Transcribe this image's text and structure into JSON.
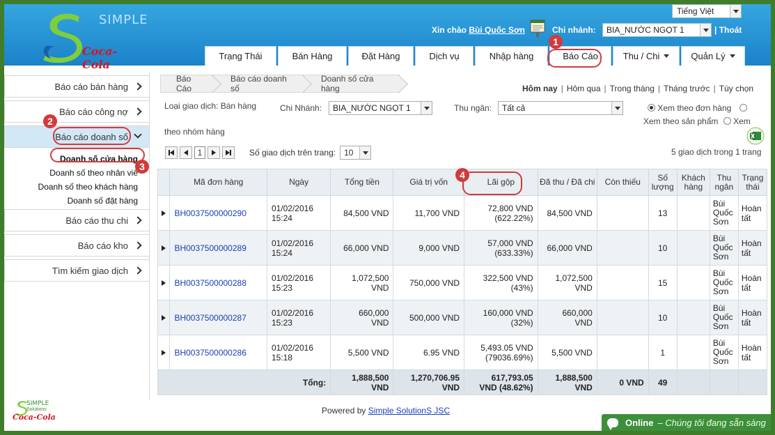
{
  "header": {
    "brand_simple": "SIMPLE",
    "brand_coke": "Coca-Cola",
    "language": "Tiếng Việt",
    "greeting_prefix": "Xin chào",
    "user_name": "Bùi Quốc Sơn",
    "branch_label": "Chi nhánh:",
    "branch_value": "BIA_NƯỚC NGỌT 1",
    "logout": "Thoát"
  },
  "nav": {
    "tabs": [
      {
        "label": "Trạng Thái"
      },
      {
        "label": "Bán Hàng"
      },
      {
        "label": "Đặt Hàng"
      },
      {
        "label": "Dịch vụ"
      },
      {
        "label": "Nhập hàng"
      },
      {
        "label": "Báo Cáo"
      },
      {
        "label": "Thu / Chi"
      },
      {
        "label": "Quản Lý"
      }
    ]
  },
  "sidebar": {
    "items": [
      {
        "label": "Báo cáo bán hàng"
      },
      {
        "label": "Báo cáo công nợ"
      },
      {
        "label": "Báo cáo doanh số"
      },
      {
        "label": "Báo cáo thu chi"
      },
      {
        "label": "Báo cáo kho"
      },
      {
        "label": "Tìm kiếm giao dịch"
      }
    ],
    "sub_items": [
      {
        "label": "Doanh số cửa hàng"
      },
      {
        "label": "Doanh số theo nhân viê"
      },
      {
        "label": "Doanh số theo khách hàng"
      },
      {
        "label": "Doanh số đặt hàng"
      }
    ],
    "logo_simple": "SIMPLE",
    "logo_solutions": "Solutions",
    "logo_coke": "Coca-Cola"
  },
  "breadcrumb": [
    "Báo Cáo",
    "Báo cáo doanh số",
    "Doanh số cửa hàng"
  ],
  "date_filters": [
    "Hôm nay",
    "Hôm qua",
    "Trong tháng",
    "Tháng trước",
    "Tùy chọn"
  ],
  "filters": {
    "transaction_type": "Loại giao dịch: Bán hàng",
    "branch_label": "Chi Nhánh:",
    "branch_value": "BIA_NƯỚC NGỌT 1",
    "cashier_label": "Thu ngân:",
    "cashier_value": "Tất cả",
    "view_by_order": "Xem theo đơn hàng",
    "view_by_product": "Xem theo sản phẩm",
    "view_word": "Xem",
    "group_text": "theo nhóm hàng"
  },
  "pager": {
    "page": "1",
    "per_page_label": "Số giao dịch trên trang:",
    "per_page_value": "10",
    "summary": "5 giao dịch trong 1 trang"
  },
  "table": {
    "headers": [
      "Mã đơn hàng",
      "Ngày",
      "Tổng tiền",
      "Giá trị vốn",
      "Lãi gộp",
      "Đã thu / Đã chi",
      "Còn thiếu",
      "Số lượng",
      "Khách hàng",
      "Thu ngân",
      "Trạng thái"
    ],
    "rows": [
      {
        "code": "BH0037500000290",
        "date": "01/02/2016",
        "time": "15:24",
        "total1": "84,500 VND",
        "total2": "",
        "cost1": "11,700 VND",
        "cost2": "",
        "profit": "72,800 VND",
        "profit_pct": "(622.22%)",
        "paid1": "84,500 VND",
        "paid2": "",
        "owed": "",
        "qty": "13",
        "customer": "",
        "cashier1": "Bùi",
        "cashier2": "Quốc",
        "cashier3": "Sơn",
        "status1": "Hoàn",
        "status2": "tất"
      },
      {
        "code": "BH0037500000289",
        "date": "01/02/2016",
        "time": "15:24",
        "total1": "66,000 VND",
        "total2": "",
        "cost1": "9,000 VND",
        "cost2": "",
        "profit": "57,000 VND",
        "profit_pct": "(633.33%)",
        "paid1": "66,000 VND",
        "paid2": "",
        "owed": "",
        "qty": "10",
        "customer": "",
        "cashier1": "Bùi",
        "cashier2": "Quốc",
        "cashier3": "Sơn",
        "status1": "Hoàn",
        "status2": "tất"
      },
      {
        "code": "BH0037500000288",
        "date": "01/02/2016",
        "time": "15:23",
        "total1": "1,072,500",
        "total2": "VND",
        "cost1": "750,000 VND",
        "cost2": "",
        "profit": "322,500 VND",
        "profit_pct": "(43%)",
        "paid1": "1,072,500",
        "paid2": "VND",
        "owed": "",
        "qty": "15",
        "customer": "",
        "cashier1": "Bùi",
        "cashier2": "Quốc",
        "cashier3": "Sơn",
        "status1": "Hoàn",
        "status2": "tất"
      },
      {
        "code": "BH0037500000287",
        "date": "01/02/2016",
        "time": "15:23",
        "total1": "660,000",
        "total2": "VND",
        "cost1": "500,000 VND",
        "cost2": "",
        "profit": "160,000 VND",
        "profit_pct": "(32%)",
        "paid1": "660,000",
        "paid2": "VND",
        "owed": "",
        "qty": "10",
        "customer": "",
        "cashier1": "Bùi",
        "cashier2": "Quốc",
        "cashier3": "Sơn",
        "status1": "Hoàn",
        "status2": "tất"
      },
      {
        "code": "BH0037500000286",
        "date": "01/02/2016",
        "time": "15:18",
        "total1": "5,500 VND",
        "total2": "",
        "cost1": "6.95 VND",
        "cost2": "",
        "profit": "5,493.05 VND",
        "profit_pct": "(79036.69%)",
        "paid1": "5,500 VND",
        "paid2": "",
        "owed": "",
        "qty": "1",
        "customer": "",
        "cashier1": "Bùi",
        "cashier2": "Quốc",
        "cashier3": "Sơn",
        "status1": "Hoàn",
        "status2": "tất"
      }
    ],
    "totals": {
      "label": "Tổng:",
      "total1": "1,888,500",
      "total2": "VND",
      "cost1": "1,270,706.95",
      "cost2": "VND",
      "profit1": "617,793.05",
      "profit2": "VND (48.62%)",
      "paid1": "1,888,500",
      "paid2": "VND",
      "owed": "0 VND",
      "qty": "49"
    }
  },
  "footer": {
    "powered_by": "Powered by",
    "company": "Simple SolutionS JSC"
  },
  "online": {
    "status": "Online",
    "message": "– Chúng tôi đang sẵn sàng"
  },
  "annotations": [
    "1",
    "2",
    "3",
    "4"
  ],
  "colors": {
    "header_blue": "#1b82c9",
    "annotation_red": "#d23b3b",
    "link_blue": "#1a3fb5",
    "online_green": "#3d8f3a"
  }
}
